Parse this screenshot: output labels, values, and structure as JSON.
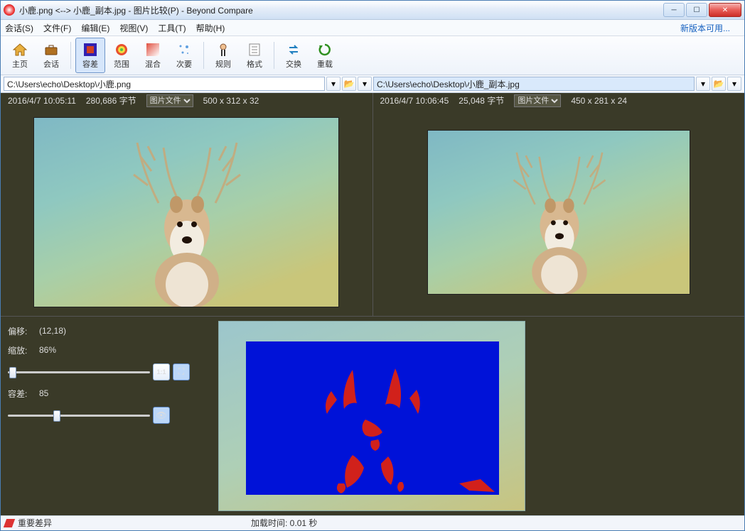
{
  "window": {
    "title": "小鹿.png <--> 小鹿_副本.jpg - 图片比较(P) - Beyond Compare"
  },
  "menu": {
    "session": "会话(S)",
    "file": "文件(F)",
    "edit": "编辑(E)",
    "view": "视图(V)",
    "tools": "工具(T)",
    "help": "帮助(H)",
    "update": "新版本可用..."
  },
  "toolbar": {
    "home": "主页",
    "session": "会话",
    "tolerance": "容差",
    "range": "范围",
    "blend": "混合",
    "next": "次要",
    "rules": "规则",
    "format": "格式",
    "swap": "交换",
    "reload": "重载"
  },
  "paths": {
    "left": "C:\\Users\\echo\\Desktop\\小鹿.png",
    "right": "C:\\Users\\echo\\Desktop\\小鹿_副本.jpg"
  },
  "meta": {
    "left": {
      "date": "2016/4/7 10:05:11",
      "size": "280,686 字节",
      "type": "图片文件",
      "dims": "500 x 312 x 32"
    },
    "right": {
      "date": "2016/4/7 10:06:45",
      "size": "25,048 字节",
      "type": "图片文件",
      "dims": "450 x 281 x 24"
    }
  },
  "controls": {
    "offset_label": "偏移:",
    "offset_value": "(12,18)",
    "zoom_label": "缩放:",
    "zoom_value": "86%",
    "tolerance_label": "容差:",
    "tolerance_value": "85"
  },
  "status": {
    "diff": "重要差异",
    "load": "加载时间: 0.01 秒"
  }
}
